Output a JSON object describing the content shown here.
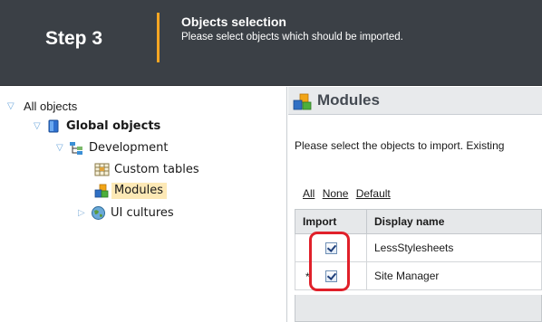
{
  "header": {
    "step": "Step 3",
    "title": "Objects selection",
    "subtitle": "Please select objects which should be imported."
  },
  "tree": {
    "root": "All objects",
    "global": "Global objects",
    "development": "Development",
    "custom_tables": "Custom tables",
    "modules": "Modules",
    "ui_cultures": "UI cultures"
  },
  "main": {
    "title": "Modules",
    "instructions": "Please select the objects to import. Existing",
    "links": [
      "All",
      "None",
      "Default"
    ],
    "columns": [
      "Import",
      "Display name"
    ],
    "rows": [
      {
        "marker": "",
        "checked": true,
        "name": "LessStylesheets"
      },
      {
        "marker": "*",
        "checked": true,
        "name": "Site Manager"
      }
    ]
  },
  "colors": {
    "header_bg": "#3b4046",
    "accent_divider": "#f5a623",
    "selected_bg": "#fde9b6",
    "highlight_red": "#e0202a"
  }
}
